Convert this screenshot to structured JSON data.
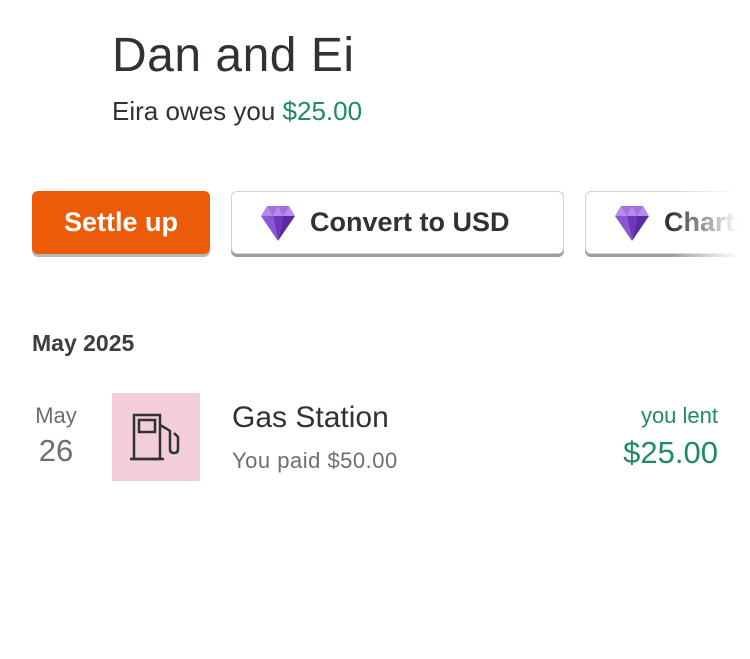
{
  "group": {
    "title": "Dan and Ei",
    "balance_prefix": "Eira owes you ",
    "balance_amount": "$25.00"
  },
  "actions": {
    "settle_label": "Settle up",
    "convert_label": "Convert to USD",
    "charts_label": "Charts",
    "premium_icon": "purple-gem-icon"
  },
  "expenses": {
    "month_header": "May 2025",
    "items": [
      {
        "date_month": "May",
        "date_day": "26",
        "category_icon": "gas-pump-icon",
        "name": "Gas Station",
        "paid_text": "You paid $50.00",
        "status_label": "you lent",
        "status_amount": "$25.00"
      }
    ]
  },
  "colors": {
    "accent_orange": "#ec5b08",
    "positive_green": "#1f8a63",
    "gem_purple": "#7b3fc4",
    "category_tile": "#f3cdd8"
  }
}
